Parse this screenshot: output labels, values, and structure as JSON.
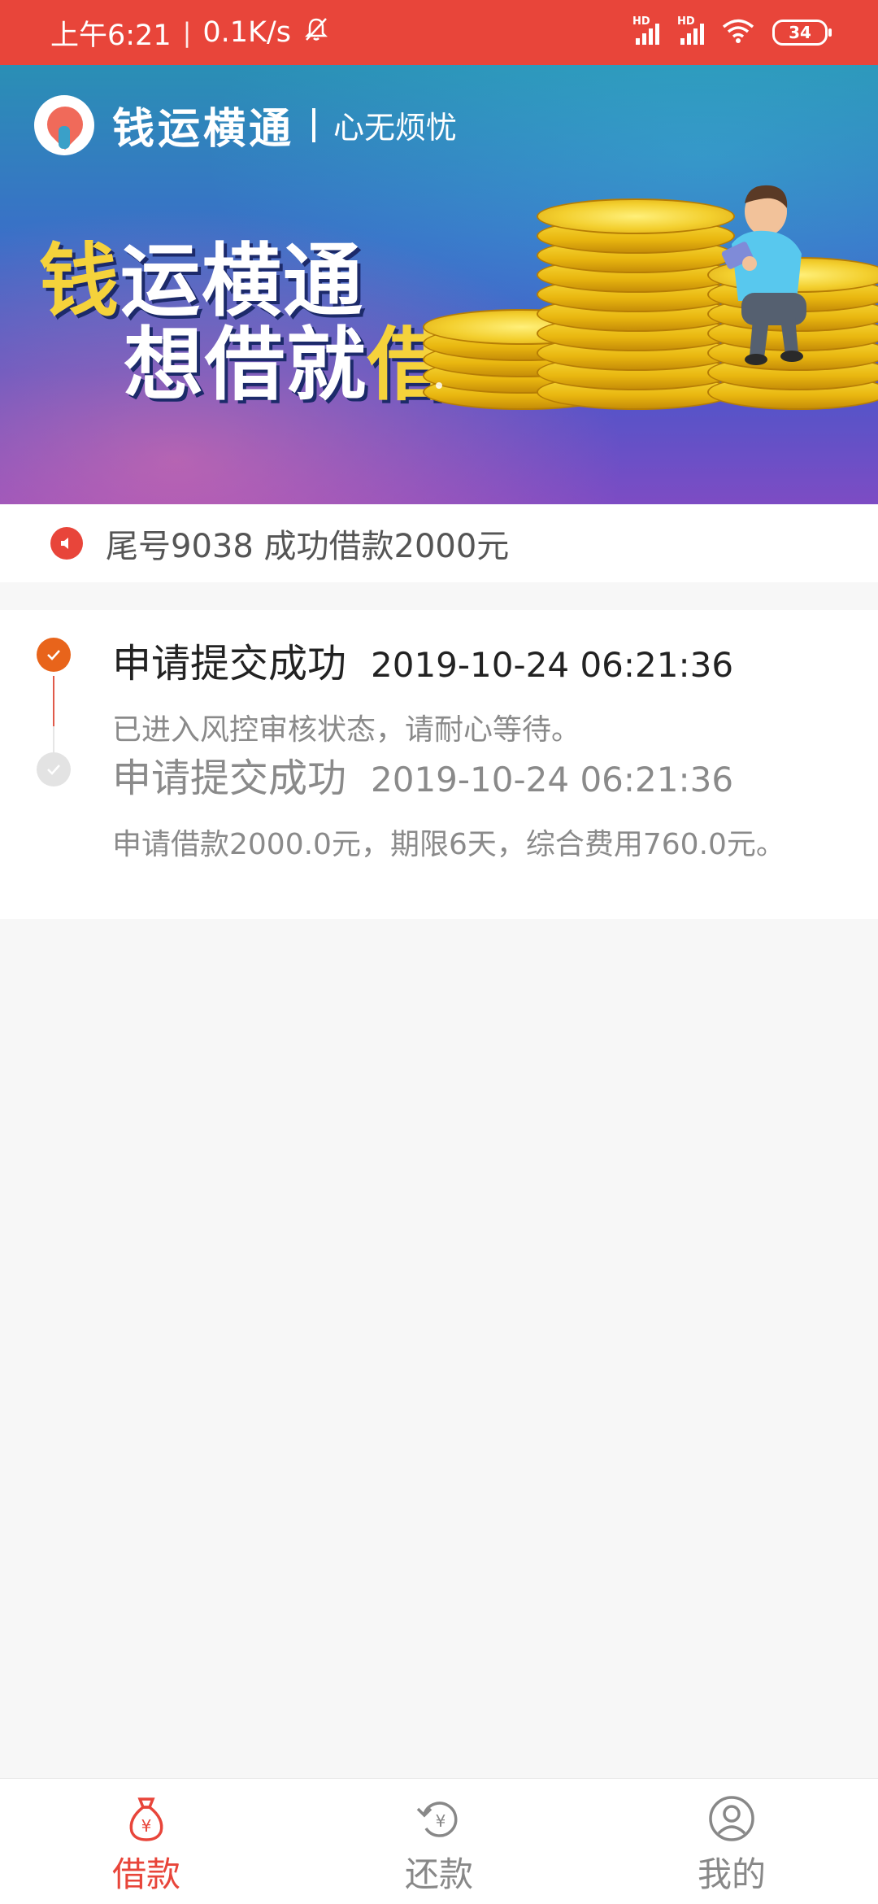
{
  "status_bar": {
    "time": "上午6:21",
    "speed": "0.1K/s",
    "signal_label_1": "HD",
    "signal_label_2": "HD",
    "battery": "34"
  },
  "banner": {
    "brand_name": "钱运横通",
    "slogan": "心无烦忧",
    "headline_line1_big": "钱",
    "headline_line1_rest": "运横通",
    "headline_line2_rest": "想借就",
    "headline_line2_big": "借"
  },
  "notice": {
    "icon": "speaker-icon",
    "text": "尾号9038 成功借款2000元"
  },
  "timeline": {
    "items": [
      {
        "title": "申请提交成功",
        "time": "2019-10-24 06:21:36",
        "description": "已进入风控审核状态，请耐心等待。",
        "state": "active"
      },
      {
        "title": "申请提交成功",
        "time": "2019-10-24 06:21:36",
        "description": "申请借款2000.0元，期限6天，综合费用760.0元。",
        "state": "done"
      }
    ]
  },
  "bottom_nav": {
    "items": [
      {
        "label": "借款",
        "icon": "money-bag-icon",
        "active": true
      },
      {
        "label": "还款",
        "icon": "repay-icon",
        "active": false
      },
      {
        "label": "我的",
        "icon": "user-icon",
        "active": false
      }
    ]
  },
  "colors": {
    "status_bar": "#e8453a",
    "accent_orange": "#e8641b",
    "active_red": "#e8453a",
    "inactive_gray": "#888888"
  }
}
